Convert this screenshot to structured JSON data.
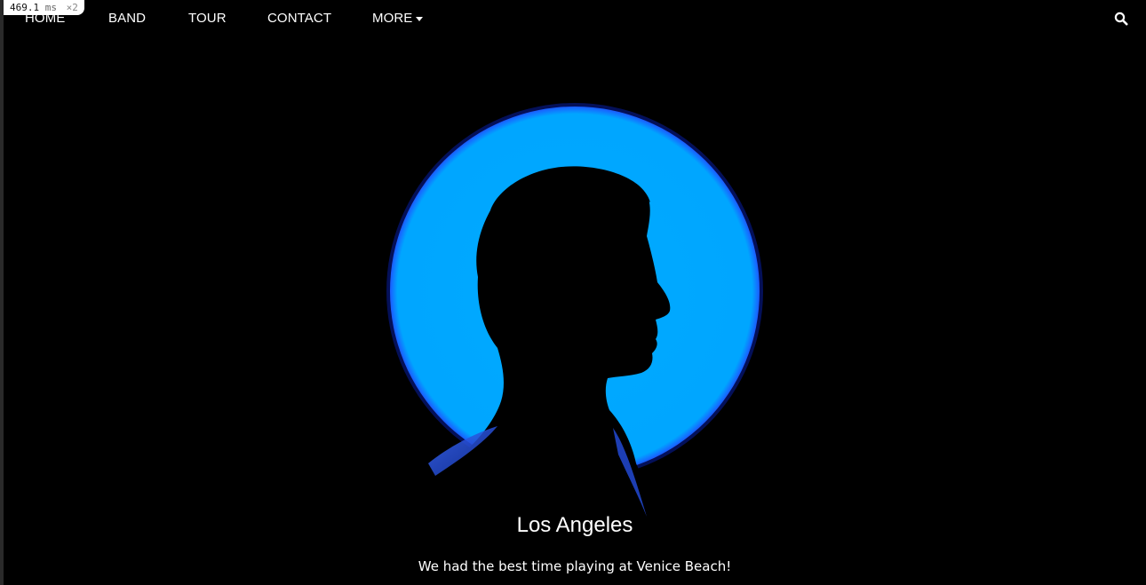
{
  "overlay": {
    "timing_value": "469.1",
    "timing_unit": "ms",
    "timing_multiplier": "×2"
  },
  "nav": {
    "items": [
      {
        "label": "HOME"
      },
      {
        "label": "BAND"
      },
      {
        "label": "TOUR"
      },
      {
        "label": "CONTACT"
      },
      {
        "label": "MORE"
      }
    ],
    "search_icon": "search-icon"
  },
  "slide": {
    "title": "Los Angeles",
    "text": "We had the best time playing at Venice Beach!"
  },
  "colors": {
    "background": "#000000",
    "accent_circle": "#00aaff",
    "text": "#ffffff"
  }
}
